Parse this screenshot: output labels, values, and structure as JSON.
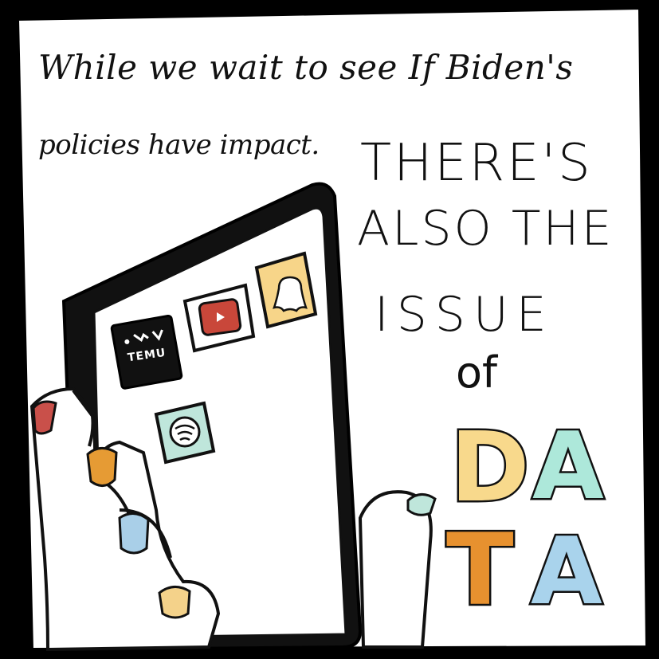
{
  "caption": {
    "line1": "While we wait to see If Biden's",
    "line2": "policies have impact."
  },
  "headline": {
    "line1": "THERE'S",
    "line2": "ALSO THE",
    "line3": "ISSUE",
    "line4": "of"
  },
  "big_word": {
    "d": "D",
    "a1": "A",
    "t": "T",
    "a2": "A"
  },
  "apps": {
    "temu_label": "TEMU"
  },
  "colors": {
    "panel": "#ffffff",
    "border": "#000000",
    "snapchat_yellow": "#f7d589",
    "youtube_red": "#c9473a",
    "d_yellow": "#f8d98c",
    "a_mint": "#ade8da",
    "t_orange": "#e7912f",
    "a_blue": "#a9d3ec",
    "nail_red": "#c9504a",
    "nail_orange": "#e69b34",
    "nail_blue": "#a9cfe8",
    "nail_yellow": "#f4d28a",
    "nail_mint": "#bfe6db"
  }
}
